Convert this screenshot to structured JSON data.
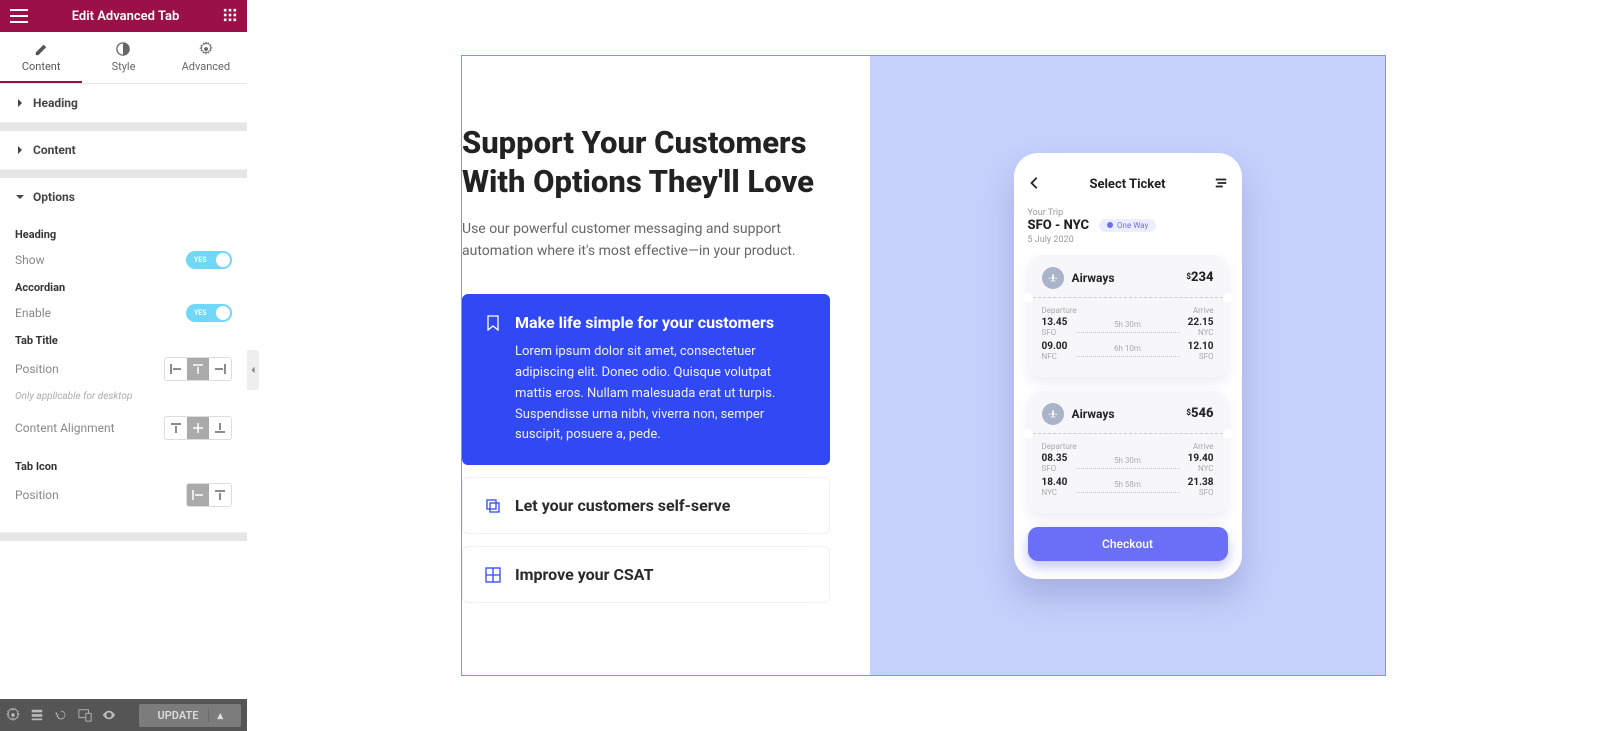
{
  "sidebar": {
    "header_title": "Edit Advanced Tab",
    "tabs": {
      "content": "Content",
      "style": "Style",
      "advanced": "Advanced"
    },
    "sections": {
      "heading": "Heading",
      "content": "Content",
      "options": "Options"
    },
    "options": {
      "heading_label": "Heading",
      "show_label": "Show",
      "show_toggle": "YES",
      "accordion_label": "Accordian",
      "enable_label": "Enable",
      "enable_toggle": "YES",
      "tab_title_label": "Tab Title",
      "position_label": "Position",
      "note": "Only applicable for desktop",
      "content_align_label": "Content Alignment",
      "tab_icon_label": "Tab Icon",
      "icon_position_label": "Position"
    },
    "footer": {
      "update": "UPDATE"
    }
  },
  "preview": {
    "heading": "Support Your Customers With Options They'll Love",
    "subtext": "Use our powerful customer messaging and support automation where it's most effective—in your product.",
    "accordion": [
      {
        "title": "Make life simple for your customers",
        "body": "Lorem ipsum dolor sit amet, consectetuer adipiscing elit. Donec odio. Quisque volutpat mattis eros. Nullam malesuada erat ut turpis. Suspendisse urna nibh, viverra non, semper suscipit, posuere a, pede."
      },
      {
        "title": "Let your customers self-serve"
      },
      {
        "title": "Improve your CSAT"
      }
    ],
    "phone": {
      "title": "Select Ticket",
      "your_trip": "Your Trip",
      "route": "SFO - NYC",
      "chip": "One Way",
      "date": "5 July 2020",
      "tickets": [
        {
          "airline": "Airways",
          "price": "234",
          "depart_label": "Departure",
          "arrive_label": "Arrive",
          "rows": [
            {
              "dep_t": "13.45",
              "dep_c": "SFO",
              "dur": "5h 30m",
              "arr_t": "22.15",
              "arr_c": "NYC"
            },
            {
              "dep_t": "09.00",
              "dep_c": "NFC",
              "dur": "6h 10m",
              "arr_t": "12.10",
              "arr_c": "SFO"
            }
          ]
        },
        {
          "airline": "Airways",
          "price": "546",
          "depart_label": "Departure",
          "arrive_label": "Arrive",
          "rows": [
            {
              "dep_t": "08.35",
              "dep_c": "SFO",
              "dur": "5h 30m",
              "arr_t": "19.40",
              "arr_c": "NYC"
            },
            {
              "dep_t": "18.40",
              "dep_c": "NYC",
              "dur": "5h 58m",
              "arr_t": "21.38",
              "arr_c": "SFO"
            }
          ]
        }
      ],
      "checkout": "Checkout"
    }
  }
}
